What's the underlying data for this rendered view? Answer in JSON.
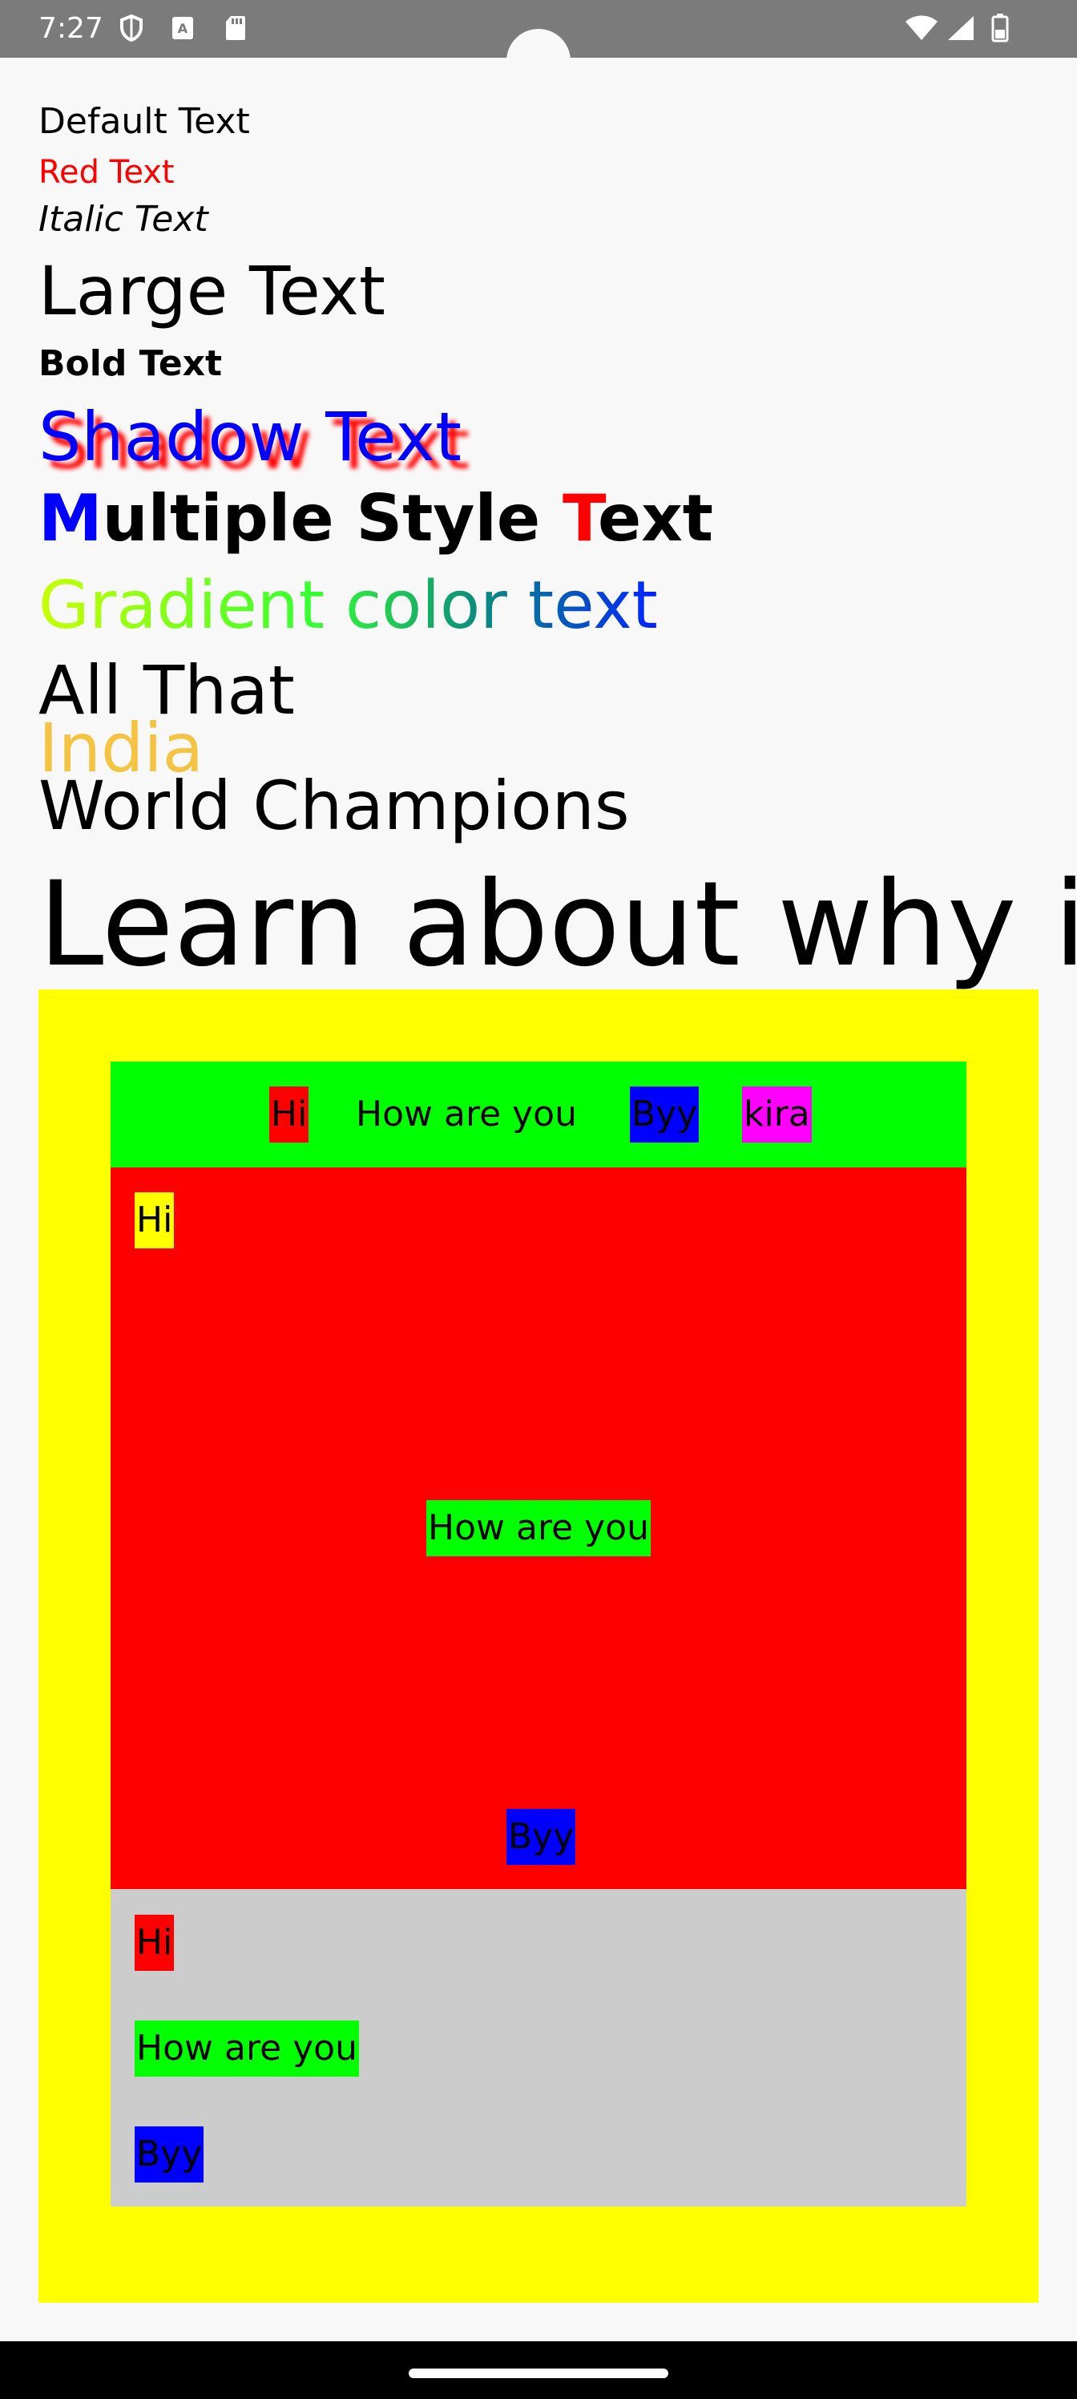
{
  "status_bar": {
    "time": "7:27",
    "left_icons": [
      "shield-icon",
      "text-a-icon",
      "sd-card-icon"
    ],
    "right_icons": [
      "wifi-icon",
      "signal-icon",
      "battery-icon"
    ]
  },
  "text_samples": {
    "default": "Default Text",
    "red": "Red Text",
    "italic": "Italic Text",
    "large": "Large Text",
    "bold": "Bold Text",
    "shadow": "Shadow Text",
    "multi_style": {
      "m": "M",
      "ultiple_style": "ultiple Style ",
      "t": "T",
      "ext": "ext"
    },
    "gradient": "Gradient color text",
    "all_that": "All That",
    "india": "India",
    "world_champions": "World Champions",
    "learn_about": "Learn about why i"
  },
  "colors": {
    "red": "#ff0000",
    "blue": "#0000ff",
    "yellow": "#ffff00",
    "green": "#00ff00",
    "magenta": "#ff00ff",
    "gray": "#cccccc",
    "india_gold": "#f5c342"
  },
  "layout_demo": {
    "row": [
      "Hi",
      "How are you",
      "Byy",
      "kira"
    ],
    "box": [
      "Hi",
      "How are you",
      "Byy"
    ],
    "column": [
      "Hi",
      "How are you",
      "Byy"
    ]
  }
}
